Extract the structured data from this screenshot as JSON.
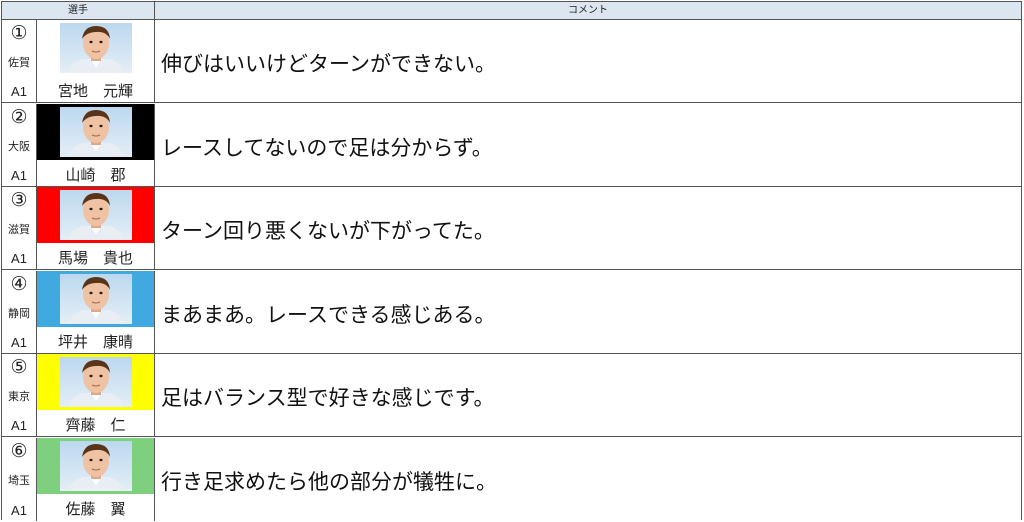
{
  "header": {
    "player": "選手",
    "comment": "コメント"
  },
  "rows": [
    {
      "number": "①",
      "prefecture": "佐賀",
      "class": "A1",
      "name": "宮地　元輝",
      "color": "#ffffff",
      "comment": "伸びはいいけどターンができない。"
    },
    {
      "number": "②",
      "prefecture": "大阪",
      "class": "A1",
      "name": "山崎　郡",
      "color": "#000000",
      "comment": "レースしてないので足は分からず。"
    },
    {
      "number": "③",
      "prefecture": "滋賀",
      "class": "A1",
      "name": "馬場　貴也",
      "color": "#ff0000",
      "comment": "ターン回り悪くないが下がってた。"
    },
    {
      "number": "④",
      "prefecture": "静岡",
      "class": "A1",
      "name": "坪井　康晴",
      "color": "#3fa9e0",
      "comment": "まあまあ。レースできる感じある。"
    },
    {
      "number": "⑤",
      "prefecture": "東京",
      "class": "A1",
      "name": "齊藤　仁",
      "color": "#ffff00",
      "comment": "足はバランス型で好きな感じです。"
    },
    {
      "number": "⑥",
      "prefecture": "埼玉",
      "class": "A1",
      "name": "佐藤　翼",
      "color": "#7ed07e",
      "comment": "行き足求めたら他の部分が犠牲に。"
    }
  ]
}
